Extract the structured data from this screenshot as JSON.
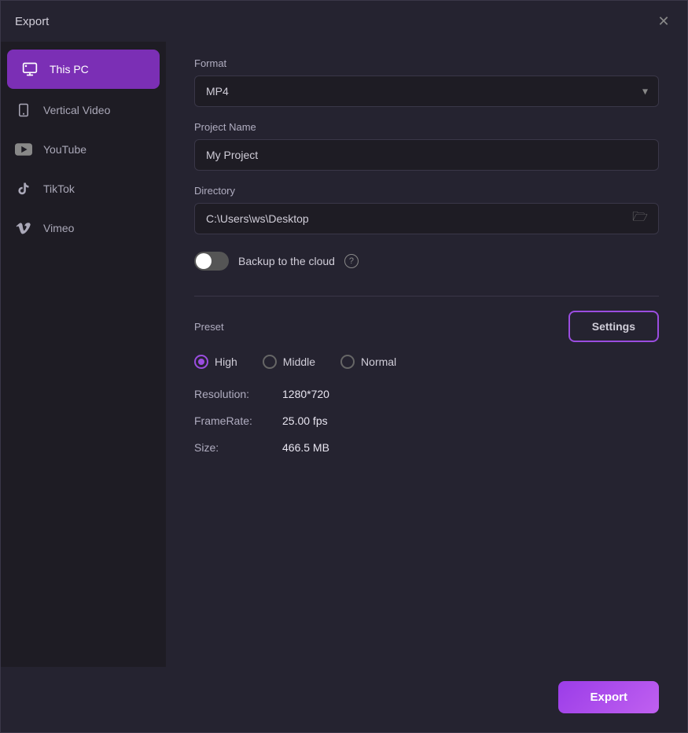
{
  "window": {
    "title": "Export",
    "close_label": "✕"
  },
  "sidebar": {
    "items": [
      {
        "id": "this-pc",
        "label": "This PC",
        "icon": "monitor",
        "active": true
      },
      {
        "id": "vertical-video",
        "label": "Vertical Video",
        "icon": "phone",
        "active": false
      },
      {
        "id": "youtube",
        "label": "YouTube",
        "icon": "youtube",
        "active": false
      },
      {
        "id": "tiktok",
        "label": "TikTok",
        "icon": "tiktok",
        "active": false
      },
      {
        "id": "vimeo",
        "label": "Vimeo",
        "icon": "vimeo",
        "active": false
      }
    ]
  },
  "content": {
    "format_label": "Format",
    "format_value": "MP4",
    "project_name_label": "Project Name",
    "project_name_value": "My Project",
    "directory_label": "Directory",
    "directory_value": "C:\\Users\\ws\\Desktop",
    "backup_label": "Backup to the cloud",
    "backup_enabled": false,
    "preset_label": "Preset",
    "settings_btn_label": "Settings",
    "presets": [
      {
        "id": "high",
        "label": "High",
        "checked": true
      },
      {
        "id": "middle",
        "label": "Middle",
        "checked": false
      },
      {
        "id": "normal",
        "label": "Normal",
        "checked": false
      }
    ],
    "resolution_label": "Resolution:",
    "resolution_value": "1280*720",
    "framerate_label": "FrameRate:",
    "framerate_value": "25.00 fps",
    "size_label": "Size:",
    "size_value": "466.5 MB"
  },
  "footer": {
    "export_btn_label": "Export"
  }
}
